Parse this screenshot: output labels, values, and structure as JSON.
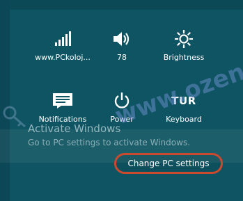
{
  "tiles": {
    "network": {
      "label": "www.PCkoloj...",
      "icon": "signal-bars-icon"
    },
    "volume": {
      "label": "78",
      "icon": "speaker-icon"
    },
    "brightness": {
      "label": "Brightness",
      "icon": "sun-icon"
    },
    "notifications": {
      "label": "Notifications",
      "icon": "message-icon"
    },
    "power": {
      "label": "Power",
      "icon": "power-icon"
    },
    "keyboard": {
      "label": "Keyboard",
      "layout": "TUR"
    }
  },
  "activation": {
    "title": "Activate Windows",
    "subtitle": "Go to PC settings to activate Windows."
  },
  "change_pc_settings": "Change PC settings",
  "watermark": "www.ozengen.com",
  "colors": {
    "background": "#0f5462",
    "highlight_ring": "#c94a2e"
  }
}
